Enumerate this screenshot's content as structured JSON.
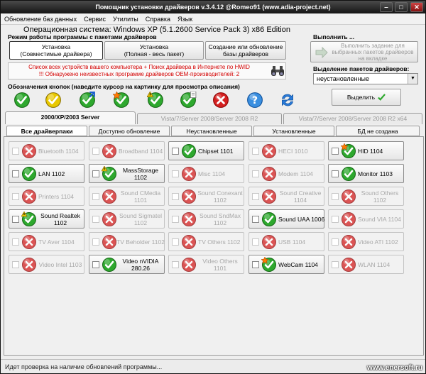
{
  "window": {
    "title": "Помощник установки драйверов v.3.4.12 @Romeo91 (www.adia-project.net)"
  },
  "menu": [
    "Обновление баз данных",
    "Сервис",
    "Утилиты",
    "Справка",
    "Язык"
  ],
  "os_title": "Операционная система: Windows XP  (5.1.2600 Service Pack 3) x86 Edition",
  "mode_group": {
    "title": "Режим работы программы с пакетами драйверов",
    "buttons": [
      {
        "line1": "Установка",
        "line2": "(Совместимые драйвера)"
      },
      {
        "line1": "Установка",
        "line2": "(Полная - весь пакет)"
      },
      {
        "line1": "Создание или обновление",
        "line2": "базы драйверов"
      }
    ],
    "banner_line1": "Список всех устройств вашего компьютера + Поиск драйвера в Интернете по HWID",
    "banner_line2": "!!! Обнаружено неизвестных программе драйверов OEM-производителей: 2"
  },
  "legend": {
    "title": "Обозначения кнопок (наведите курсор на картинку для просмотра описания)",
    "icons": [
      "green-check",
      "yellow-check",
      "green-check-arrow",
      "green-check-star",
      "green-check-warning",
      "green-check-note",
      "red-x",
      "help-question",
      "refresh-arrows"
    ]
  },
  "execute": {
    "title": "Выполнить ...",
    "button": "Выполнить задание для выбранных пакетов драйверов на вкладке"
  },
  "selection": {
    "title": "Выделение пакетов драйверов:",
    "value": "неустановленные",
    "button": "Выделить"
  },
  "os_tabs": [
    "2000/XP/2003 Server",
    "Vista/7/Server 2008/Server 2008 R2",
    "Vista/7/Server 2008/Server 2008 R2 x64"
  ],
  "sub_tabs": [
    "Все драйверпаки",
    "Доступно обновление",
    "Неустановленные",
    "Установленные",
    "БД не создана"
  ],
  "drivers": [
    {
      "name": "Bluetooth 1104",
      "icon": "red-x",
      "enabled": false
    },
    {
      "name": "Broadband 1104",
      "icon": "red-x",
      "enabled": false
    },
    {
      "name": "Chipset 1101",
      "icon": "green-check",
      "enabled": true
    },
    {
      "name": "HECI 1010",
      "icon": "red-x",
      "enabled": false
    },
    {
      "name": "HID 1104",
      "icon": "green-check-star",
      "enabled": true
    },
    {
      "name": "LAN 1102",
      "icon": "green-check",
      "enabled": true
    },
    {
      "name": "MassStorage 1102",
      "icon": "green-check-warning",
      "enabled": true
    },
    {
      "name": "Misc 1104",
      "icon": "red-x",
      "enabled": false
    },
    {
      "name": "Modem 1104",
      "icon": "red-x",
      "enabled": false
    },
    {
      "name": "Monitor 1103",
      "icon": "green-check",
      "enabled": true
    },
    {
      "name": "Printers 1104",
      "icon": "red-x",
      "enabled": false
    },
    {
      "name": "Sound CMedia 1101",
      "icon": "red-x",
      "enabled": false
    },
    {
      "name": "Sound Conexant 1102",
      "icon": "red-x",
      "enabled": false
    },
    {
      "name": "Sound Creative 1104",
      "icon": "red-x",
      "enabled": false
    },
    {
      "name": "Sound Others 1102",
      "icon": "red-x",
      "enabled": false
    },
    {
      "name": "Sound Realtek 1102",
      "icon": "green-check-warning",
      "enabled": true
    },
    {
      "name": "Sound Sigmatel 1102",
      "icon": "red-x",
      "enabled": false
    },
    {
      "name": "Sound SndMax 1102",
      "icon": "red-x",
      "enabled": false
    },
    {
      "name": "Sound UAA 1006",
      "icon": "green-check",
      "enabled": true
    },
    {
      "name": "Sound VIA 1104",
      "icon": "red-x",
      "enabled": false
    },
    {
      "name": "TV Aver 1104",
      "icon": "red-x",
      "enabled": false
    },
    {
      "name": "TV Beholder 1102",
      "icon": "red-x",
      "enabled": false
    },
    {
      "name": "TV Others 1102",
      "icon": "red-x",
      "enabled": false
    },
    {
      "name": "USB 1104",
      "icon": "red-x",
      "enabled": false
    },
    {
      "name": "Video ATI 1102",
      "icon": "red-x",
      "enabled": false
    },
    {
      "name": "Video Intel 1103",
      "icon": "red-x",
      "enabled": false
    },
    {
      "name": "Video nVIDIA 280.26",
      "icon": "green-check",
      "enabled": true
    },
    {
      "name": "Video Others 1101",
      "icon": "red-x",
      "enabled": false
    },
    {
      "name": "WebCam 1104",
      "icon": "green-check-star",
      "enabled": true
    },
    {
      "name": "WLAN 1104",
      "icon": "red-x",
      "enabled": false
    }
  ],
  "status": "Идет проверка на наличие обновлений программы...",
  "watermark": "www.enersoft.ru",
  "colors": {
    "accent_red": "#d40000",
    "check_green": "#2ea82e",
    "x_red": "#d42020",
    "warn_yellow": "#e8c800"
  }
}
